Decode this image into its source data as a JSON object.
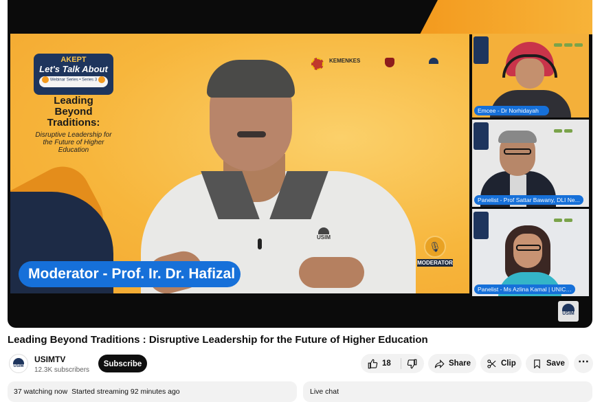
{
  "video": {
    "title": "Leading Beyond Traditions : Disruptive Leadership for the Future of Higher Education",
    "overlay": {
      "brand_line1": "AKEPT",
      "brand_line2": "Let's Talk About",
      "brand_series": "Webinar Series • Series 3",
      "headline": "Leading Beyond Traditions:",
      "subheadline": "Disruptive Leadership for the Future of Higher Education",
      "partner_logo_text": "KEMENKES",
      "lower_third": "Moderator - Prof. Ir. Dr. Hafizal",
      "moderator_badge": "MODERATOR",
      "shirt_logo": "USIM",
      "corner_logo": "USIM"
    },
    "panelists": [
      {
        "caption": "Emcee - Dr Norhidayah"
      },
      {
        "caption": "Panelist - Prof Sattar Bawany, DLI Ne..."
      },
      {
        "caption": "Panelist - Ms Azlina Kamal | UNICEF"
      }
    ]
  },
  "channel": {
    "name": "USIMTV",
    "subscribers": "12.3K subscribers",
    "avatar_text": "USIM",
    "subscribe_label": "Subscribe"
  },
  "actions": {
    "like_count": "18",
    "share_label": "Share",
    "clip_label": "Clip",
    "save_label": "Save",
    "more_label": "⋯"
  },
  "stats": {
    "watching": "37 watching now",
    "started": "Started streaming 92 minutes ago"
  },
  "chat": {
    "label": "Live chat"
  },
  "colors": {
    "accent_orange": "#f6b63c",
    "lower_third_blue": "#1670d9",
    "navy": "#1e355d"
  }
}
